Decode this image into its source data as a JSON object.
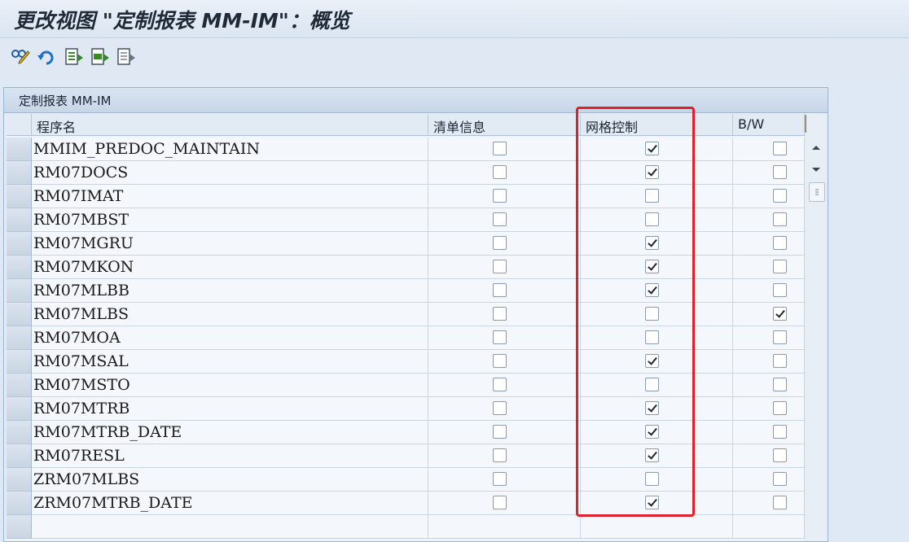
{
  "window": {
    "title": "更改视图 \"定制报表 MM-IM\"：概览"
  },
  "toolbar": {
    "buttons": [
      {
        "name": "display-change-icon"
      },
      {
        "name": "undo-icon"
      },
      {
        "name": "select-all-icon"
      },
      {
        "name": "select-block-icon"
      },
      {
        "name": "deselect-all-icon"
      }
    ]
  },
  "table": {
    "title": "定制报表 MM-IM",
    "columns": [
      "程序名",
      "清单信息",
      "网格控制",
      "B/W"
    ],
    "rows": [
      {
        "program": "MMIM_PREDOC_MAINTAIN",
        "list_info": false,
        "grid_control": true,
        "bw": false
      },
      {
        "program": "RM07DOCS",
        "list_info": false,
        "grid_control": true,
        "bw": false
      },
      {
        "program": "RM07IMAT",
        "list_info": false,
        "grid_control": false,
        "bw": false
      },
      {
        "program": "RM07MBST",
        "list_info": false,
        "grid_control": false,
        "bw": false
      },
      {
        "program": "RM07MGRU",
        "list_info": false,
        "grid_control": true,
        "bw": false
      },
      {
        "program": "RM07MKON",
        "list_info": false,
        "grid_control": true,
        "bw": false
      },
      {
        "program": "RM07MLBB",
        "list_info": false,
        "grid_control": true,
        "bw": false
      },
      {
        "program": "RM07MLBS",
        "list_info": false,
        "grid_control": false,
        "bw": true
      },
      {
        "program": "RM07MOA",
        "list_info": false,
        "grid_control": false,
        "bw": false
      },
      {
        "program": "RM07MSAL",
        "list_info": false,
        "grid_control": true,
        "bw": false
      },
      {
        "program": "RM07MSTO",
        "list_info": false,
        "grid_control": false,
        "bw": false
      },
      {
        "program": "RM07MTRB",
        "list_info": false,
        "grid_control": true,
        "bw": false
      },
      {
        "program": "RM07MTRB_DATE",
        "list_info": false,
        "grid_control": true,
        "bw": false
      },
      {
        "program": "RM07RESL",
        "list_info": false,
        "grid_control": true,
        "bw": false
      },
      {
        "program": "ZRM07MLBS",
        "list_info": false,
        "grid_control": false,
        "bw": false
      },
      {
        "program": "ZRM07MTRB_DATE",
        "list_info": false,
        "grid_control": true,
        "bw": false
      }
    ]
  },
  "colors": {
    "highlight": "#e0202a",
    "accent": "#1f6fc2"
  }
}
